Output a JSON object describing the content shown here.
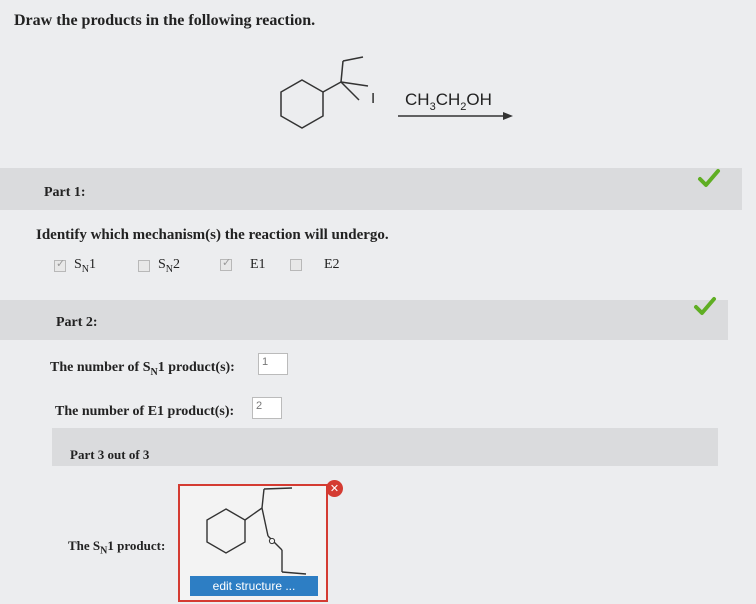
{
  "question": {
    "title": "Draw the products in the following reaction."
  },
  "reaction": {
    "leaving_group": "I",
    "reagent_parts": [
      "CH",
      "3",
      "CH",
      "2",
      "OH"
    ]
  },
  "part1": {
    "label": "Part 1:",
    "question": "Identify which mechanism(s) the reaction will undergo.",
    "options": [
      {
        "main": "S",
        "sub": "N",
        "suffix": "1",
        "checked": true
      },
      {
        "main": "S",
        "sub": "N",
        "suffix": "2",
        "checked": false
      },
      {
        "main": "E1",
        "sub": "",
        "suffix": "",
        "checked": true
      },
      {
        "main": "E2",
        "sub": "",
        "suffix": "",
        "checked": false
      }
    ],
    "status_icon": "checkmark-icon"
  },
  "part2": {
    "label": "Part 2:",
    "sn1_label": {
      "prefix": "The number of S",
      "sub": "N",
      "suffix": "1 product(s):"
    },
    "sn1_value": "1",
    "e1_label": "The number of E1 product(s):",
    "e1_value": "2",
    "status_icon": "checkmark-icon"
  },
  "part3": {
    "label": "Part 3 out of 3",
    "product_label": {
      "prefix": "The S",
      "sub": "N",
      "suffix": "1 product:"
    },
    "edit_button": "edit structure ...",
    "close_icon": "close-icon"
  },
  "colors": {
    "check": "#5fae23",
    "error": "#d43b32",
    "button": "#2d7ec4"
  }
}
